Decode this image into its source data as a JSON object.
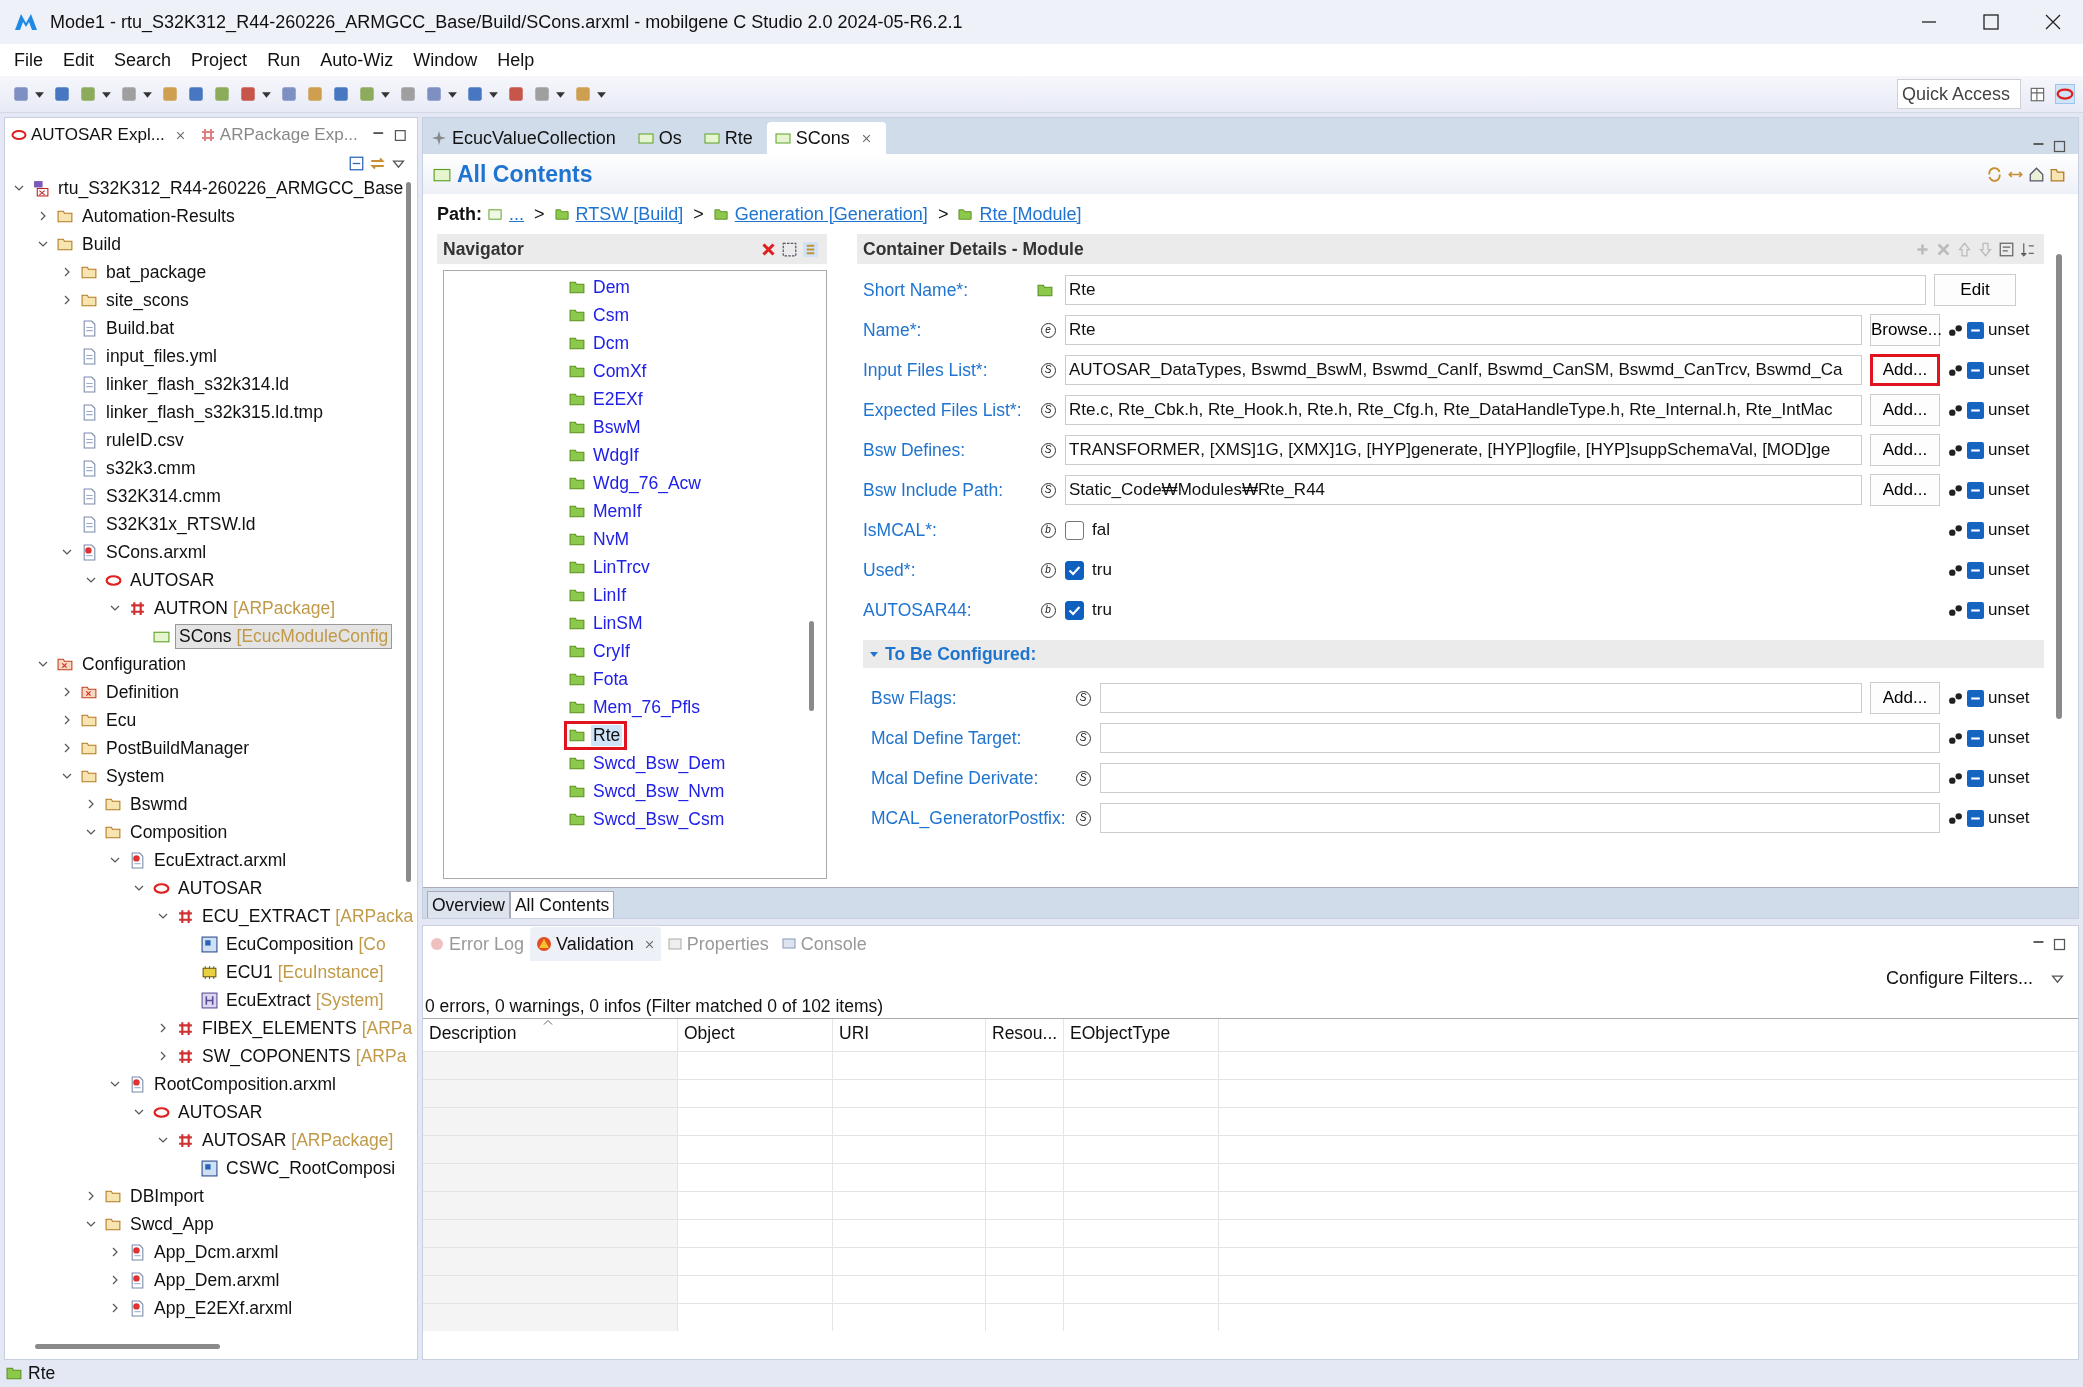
{
  "window": {
    "title": "Mode1 - rtu_S32K312_R44-260226_ARMGCC_Base/Build/SCons.arxml - mobilgene C Studio 2.0 2024-05-R6.2.1"
  },
  "menu": [
    "File",
    "Edit",
    "Search",
    "Project",
    "Run",
    "Auto-Wiz",
    "Window",
    "Help"
  ],
  "quick_access": {
    "placeholder": "Quick Access"
  },
  "explorer": {
    "tabs": [
      {
        "label": "AUTOSAR Expl...",
        "selected": true
      },
      {
        "label": "ARPackage Exp...",
        "selected": false
      }
    ],
    "tree": [
      {
        "label": "rtu_S32K312_R44-260226_ARMGCC_Base",
        "kind": "project",
        "expanded": true,
        "selected": false,
        "children": [
          {
            "label": "Automation-Results",
            "kind": "folder",
            "expanded": false,
            "selected": false
          },
          {
            "label": "Build",
            "kind": "folder",
            "expanded": true,
            "selected": false,
            "children": [
              {
                "label": "bat_package",
                "kind": "folder",
                "expanded": false,
                "selected": false
              },
              {
                "label": "site_scons",
                "kind": "folder",
                "expanded": false,
                "selected": false
              },
              {
                "label": "Build.bat",
                "kind": "file",
                "selected": false
              },
              {
                "label": "input_files.yml",
                "kind": "file",
                "selected": false
              },
              {
                "label": "linker_flash_s32k314.ld",
                "kind": "file",
                "selected": false
              },
              {
                "label": "linker_flash_s32k315.ld.tmp",
                "kind": "file",
                "selected": false
              },
              {
                "label": "ruleID.csv",
                "kind": "file",
                "selected": false
              },
              {
                "label": "s32k3.cmm",
                "kind": "file",
                "selected": false
              },
              {
                "label": "S32K314.cmm",
                "kind": "file",
                "selected": false
              },
              {
                "label": "S32K31x_RTSW.ld",
                "kind": "file",
                "selected": false
              },
              {
                "label": "SCons.arxml",
                "kind": "arxml",
                "expanded": true,
                "selected": false,
                "children": [
                  {
                    "label": "AUTOSAR",
                    "kind": "autosar",
                    "expanded": true,
                    "selected": false,
                    "children": [
                      {
                        "label": "AUTRON",
                        "tag": "[ARPackage]",
                        "kind": "package",
                        "expanded": true,
                        "selected": false,
                        "children": [
                          {
                            "label": "SCons",
                            "tag": "[EcucModuleConfig",
                            "kind": "module",
                            "selected": true
                          }
                        ]
                      }
                    ]
                  }
                ]
              }
            ]
          },
          {
            "label": "Configuration",
            "kind": "config",
            "expanded": true,
            "selected": false,
            "children": [
              {
                "label": "Definition",
                "kind": "config",
                "expanded": false,
                "selected": false
              },
              {
                "label": "Ecu",
                "kind": "folder",
                "expanded": false,
                "selected": false
              },
              {
                "label": "PostBuildManager",
                "kind": "folder",
                "expanded": false,
                "selected": false
              },
              {
                "label": "System",
                "kind": "folder",
                "expanded": true,
                "selected": false,
                "children": [
                  {
                    "label": "Bswmd",
                    "kind": "folder",
                    "expanded": false,
                    "selected": false
                  },
                  {
                    "label": "Composition",
                    "kind": "folder",
                    "expanded": true,
                    "selected": false,
                    "children": [
                      {
                        "label": "EcuExtract.arxml",
                        "kind": "arxml",
                        "expanded": true,
                        "selected": false,
                        "children": [
                          {
                            "label": "AUTOSAR",
                            "kind": "autosar",
                            "expanded": true,
                            "selected": false,
                            "children": [
                              {
                                "label": "ECU_EXTRACT",
                                "tag": "[ARPacka",
                                "kind": "package",
                                "expanded": true,
                                "selected": false,
                                "children": [
                                  {
                                    "label": "EcuComposition",
                                    "tag": "[Co",
                                    "kind": "composition",
                                    "selected": false
                                  },
                                  {
                                    "label": "ECU1",
                                    "tag": "[EcuInstance]",
                                    "kind": "ecu",
                                    "selected": false
                                  },
                                  {
                                    "label": "EcuExtract",
                                    "tag": "[System]",
                                    "kind": "system",
                                    "selected": false
                                  }
                                ]
                              },
                              {
                                "label": "FIBEX_ELEMENTS",
                                "tag": "[ARPa",
                                "kind": "package",
                                "expanded": false,
                                "selected": false
                              },
                              {
                                "label": "SW_COPONENTS",
                                "tag": "[ARPa",
                                "kind": "package",
                                "expanded": false,
                                "selected": false
                              }
                            ]
                          }
                        ]
                      },
                      {
                        "label": "RootComposition.arxml",
                        "kind": "arxml",
                        "expanded": true,
                        "selected": false,
                        "children": [
                          {
                            "label": "AUTOSAR",
                            "kind": "autosar",
                            "expanded": true,
                            "selected": false,
                            "children": [
                              {
                                "label": "AUTOSAR",
                                "tag": "[ARPackage]",
                                "kind": "package",
                                "expanded": true,
                                "selected": false,
                                "children": [
                                  {
                                    "label": "CSWC_RootComposi",
                                    "kind": "composition",
                                    "selected": false
                                  }
                                ]
                              }
                            ]
                          }
                        ]
                      }
                    ]
                  },
                  {
                    "label": "DBImport",
                    "kind": "folder",
                    "expanded": false,
                    "selected": false
                  },
                  {
                    "label": "Swcd_App",
                    "kind": "folder",
                    "expanded": true,
                    "selected": false,
                    "children": [
                      {
                        "label": "App_Dcm.arxml",
                        "kind": "arxml",
                        "expanded": false,
                        "selected": false
                      },
                      {
                        "label": "App_Dem.arxml",
                        "kind": "arxml",
                        "expanded": false,
                        "selected": false
                      },
                      {
                        "label": "App_E2EXf.arxml",
                        "kind": "arxml",
                        "expanded": false,
                        "selected": false
                      }
                    ]
                  }
                ]
              }
            ]
          }
        ]
      }
    ]
  },
  "editor": {
    "tabs": [
      {
        "label": "EcucValueCollection",
        "selected": false
      },
      {
        "label": "Os",
        "selected": false
      },
      {
        "label": "Rte",
        "selected": false
      },
      {
        "label": "SCons",
        "selected": true
      }
    ],
    "heading": "All Contents",
    "path": {
      "label": "Path:",
      "crumbs": [
        {
          "label": "...",
          "separator": ">"
        },
        {
          "label": "RTSW [Build]",
          "separator": ">"
        },
        {
          "label": "Generation [Generation]",
          "separator": ">"
        },
        {
          "label": "Rte [Module]"
        }
      ]
    },
    "navigator": {
      "title": "Navigator",
      "items": [
        {
          "label": "Dem",
          "selected": false,
          "highlighted": false
        },
        {
          "label": "Csm",
          "selected": false,
          "highlighted": false
        },
        {
          "label": "Dcm",
          "selected": false,
          "highlighted": false
        },
        {
          "label": "ComXf",
          "selected": false,
          "highlighted": false
        },
        {
          "label": "E2EXf",
          "selected": false,
          "highlighted": false
        },
        {
          "label": "BswM",
          "selected": false,
          "highlighted": false
        },
        {
          "label": "WdgIf",
          "selected": false,
          "highlighted": false
        },
        {
          "label": "Wdg_76_Acw",
          "selected": false,
          "highlighted": false
        },
        {
          "label": "MemIf",
          "selected": false,
          "highlighted": false
        },
        {
          "label": "NvM",
          "selected": false,
          "highlighted": false
        },
        {
          "label": "LinTrcv",
          "selected": false,
          "highlighted": false
        },
        {
          "label": "LinIf",
          "selected": false,
          "highlighted": false
        },
        {
          "label": "LinSM",
          "selected": false,
          "highlighted": false
        },
        {
          "label": "CryIf",
          "selected": false,
          "highlighted": false
        },
        {
          "label": "Fota",
          "selected": false,
          "highlighted": false
        },
        {
          "label": "Mem_76_Pfls",
          "selected": false,
          "highlighted": false
        },
        {
          "label": "Rte",
          "selected": true,
          "highlighted": true
        },
        {
          "label": "Swcd_Bsw_Dem",
          "selected": false,
          "highlighted": false
        },
        {
          "label": "Swcd_Bsw_Nvm",
          "selected": false,
          "highlighted": false
        },
        {
          "label": "Swcd_Bsw_Csm",
          "selected": false,
          "highlighted": false
        }
      ]
    },
    "details": {
      "title": "Container Details - Module",
      "fields": [
        {
          "label": "Short Name*:",
          "kind": "name",
          "value": "Rte",
          "button": {
            "label": "Edit",
            "highlighted": false
          }
        },
        {
          "label": "Name*:",
          "kind": "text",
          "type": "e",
          "value": "Rte",
          "button": {
            "label": "Browse...",
            "highlighted": false
          },
          "status": "unset"
        },
        {
          "label": "Input Files List*:",
          "kind": "text",
          "type": "S",
          "value": "AUTOSAR_DataTypes, Bswmd_BswM, Bswmd_CanIf, Bswmd_CanSM, Bswmd_CanTrcv, Bswmd_Ca",
          "button": {
            "label": "Add...",
            "highlighted": true
          },
          "status": "unset"
        },
        {
          "label": "Expected Files List*:",
          "kind": "text",
          "type": "S",
          "value": "Rte.c, Rte_Cbk.h, Rte_Hook.h, Rte.h, Rte_Cfg.h, Rte_DataHandleType.h, Rte_Internal.h, Rte_IntMac",
          "button": {
            "label": "Add...",
            "highlighted": false
          },
          "status": "unset"
        },
        {
          "label": "Bsw Defines:",
          "kind": "text",
          "type": "S",
          "value": "TRANSFORMER, [XMS]1G, [XMX]1G, [HYP]generate, [HYP]logfile, [HYP]suppSchemaVal, [MOD]ge",
          "button": {
            "label": "Add...",
            "highlighted": false
          },
          "status": "unset"
        },
        {
          "label": "Bsw Include Path:",
          "kind": "text",
          "type": "S",
          "value": "Static_Code₩Modules₩Rte_R44",
          "button": {
            "label": "Add...",
            "highlighted": false
          },
          "status": "unset"
        },
        {
          "label": "IsMCAL*:",
          "kind": "checkbox",
          "type": "b",
          "checked": false,
          "value": "fal",
          "status": "unset"
        },
        {
          "label": "Used*:",
          "kind": "checkbox",
          "type": "b",
          "checked": true,
          "value": "tru",
          "status": "unset"
        },
        {
          "label": "AUTOSAR44:",
          "kind": "checkbox",
          "type": "b",
          "checked": true,
          "value": "tru",
          "status": "unset"
        }
      ],
      "section": {
        "title": "To Be Configured:",
        "expanded": true,
        "fields": [
          {
            "label": "Bsw Flags:",
            "type": "S",
            "button": {
              "label": "Add...",
              "highlighted": false
            },
            "status": "unset"
          },
          {
            "label": "Mcal Define Target:",
            "type": "S",
            "status": "unset"
          },
          {
            "label": "Mcal Define Derivate:",
            "type": "S",
            "status": "unset"
          },
          {
            "label": "MCAL_GeneratorPostfix:",
            "type": "S",
            "status": "unset"
          }
        ]
      }
    },
    "page_tabs": [
      {
        "label": "Overview",
        "selected": false
      },
      {
        "label": "All Contents",
        "selected": true
      }
    ]
  },
  "views": {
    "tabs": [
      {
        "label": "Error Log",
        "selected": false
      },
      {
        "label": "Validation",
        "selected": true
      },
      {
        "label": "Properties",
        "selected": false
      },
      {
        "label": "Console",
        "selected": false
      }
    ],
    "configure": "Configure Filters...",
    "summary": "0 errors, 0 warnings, 0 infos (Filter matched 0 of 102 items)",
    "columns": [
      "Description",
      "Object",
      "URI",
      "Resou...",
      "EObjectType"
    ]
  },
  "status_bar": {
    "text": "Rte"
  }
}
